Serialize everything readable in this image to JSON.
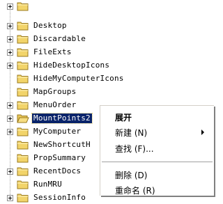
{
  "tree": {
    "items": [
      {
        "label": "Desktop",
        "expandable": true
      },
      {
        "label": "Discardable",
        "expandable": true
      },
      {
        "label": "FileExts",
        "expandable": true
      },
      {
        "label": "HideDesktopIcons",
        "expandable": true
      },
      {
        "label": "HideMyComputerIcons",
        "expandable": false
      },
      {
        "label": "MapGroups",
        "expandable": false
      },
      {
        "label": "MenuOrder",
        "expandable": true
      },
      {
        "label": "MountPoints2",
        "expandable": true,
        "selected": true
      },
      {
        "label": "MyComputer",
        "expandable": true
      },
      {
        "label": "NewShortcutH",
        "expandable": false
      },
      {
        "label": "PropSummary",
        "expandable": false
      },
      {
        "label": "RecentDocs",
        "expandable": true
      },
      {
        "label": "RunMRU",
        "expandable": false
      },
      {
        "label": "SessionInfo",
        "expandable": true
      },
      {
        "label": "",
        "expandable": true
      }
    ]
  },
  "context_menu": {
    "expand": "展开",
    "new": "新建 (N)",
    "find": "查找 (F)...",
    "delete": "删除 (D)",
    "rename": "重命名 (R)"
  },
  "colors": {
    "selection": "#0a246a",
    "folder": "#f2d46a"
  }
}
